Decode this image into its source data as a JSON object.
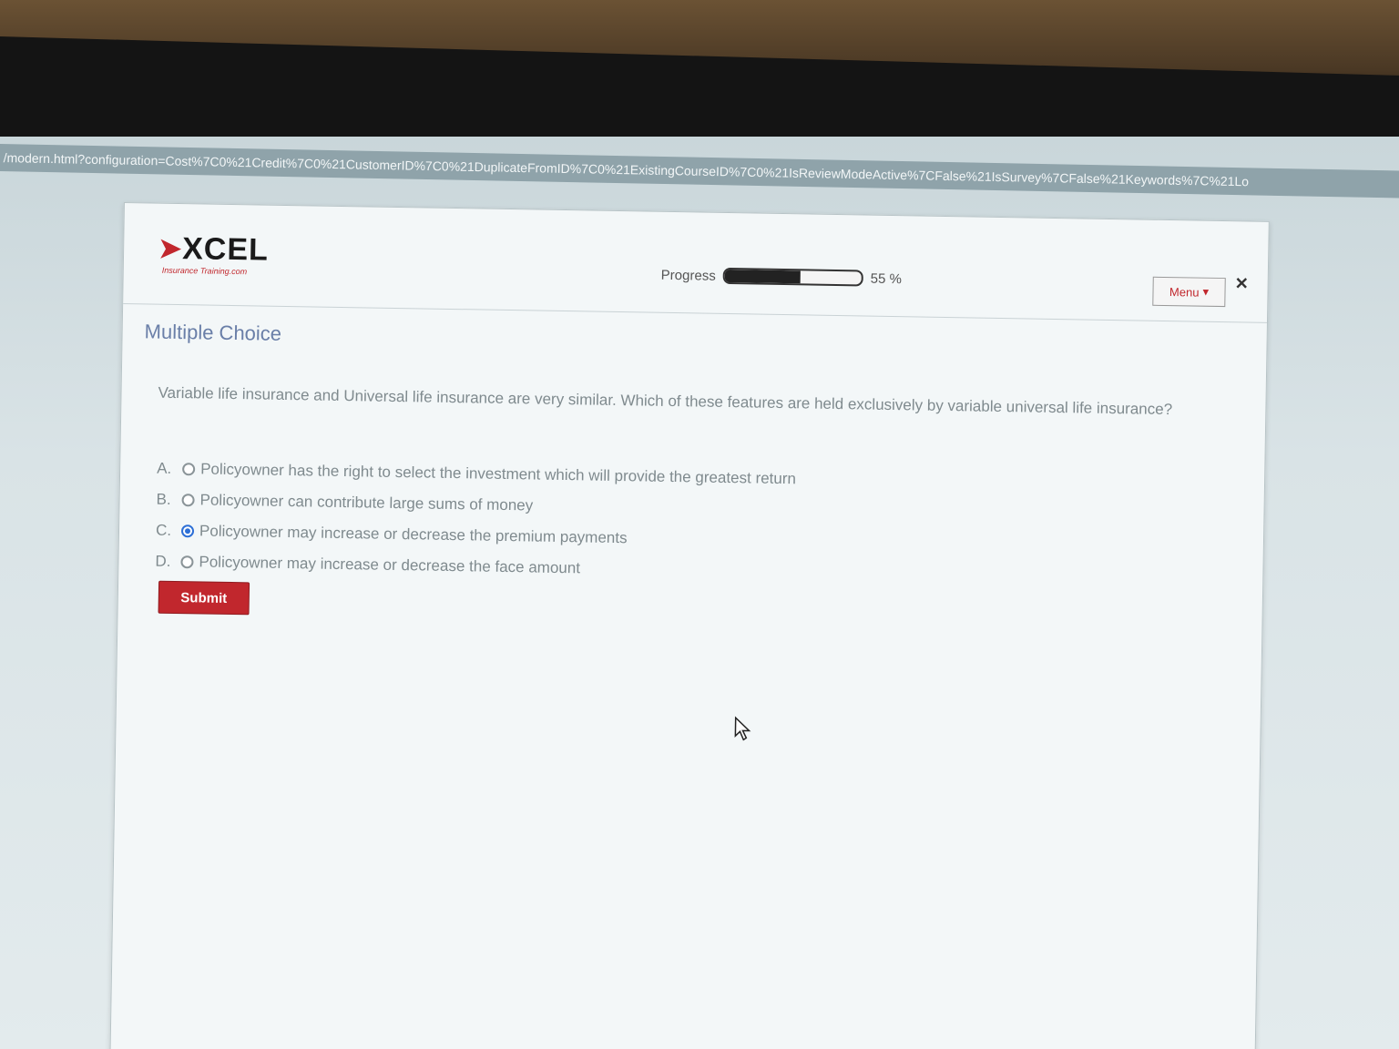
{
  "browser": {
    "url": "/modern.html?configuration=Cost%7C0%21Credit%7C0%21CustomerID%7C0%21DuplicateFromID%7C0%21ExistingCourseID%7C0%21IsReviewModeActive%7CFalse%21IsSurvey%7CFalse%21Keywords%7C%21Lo"
  },
  "header": {
    "logo_text": "XCEL",
    "logo_tagline": "Insurance Training.com",
    "progress_label": "Progress",
    "progress_value": 0.55,
    "progress_text": "55 %",
    "menu_label": "Menu",
    "close_symbol": "✕"
  },
  "content": {
    "section_title": "Multiple Choice",
    "question": "Variable life insurance and Universal life insurance are very similar. Which of these features are held exclusively by variable universal life insurance?",
    "options": [
      {
        "letter": "A.",
        "text": "Policyowner has the right to select the investment which will provide the greatest return",
        "selected": false
      },
      {
        "letter": "B.",
        "text": "Policyowner can contribute large sums of money",
        "selected": false
      },
      {
        "letter": "C.",
        "text": "Policyowner may increase or decrease the premium payments",
        "selected": true
      },
      {
        "letter": "D.",
        "text": "Policyowner may increase or decrease the face amount",
        "selected": false
      }
    ],
    "submit_label": "Submit"
  },
  "colors": {
    "brand_red": "#c1272d",
    "title_blue": "#6a7fa8",
    "radio_selected": "#2d6fd6"
  },
  "icons": {
    "close": "close-icon",
    "menu_caret": "chevron-down-icon",
    "cursor": "mouse-pointer-icon"
  }
}
